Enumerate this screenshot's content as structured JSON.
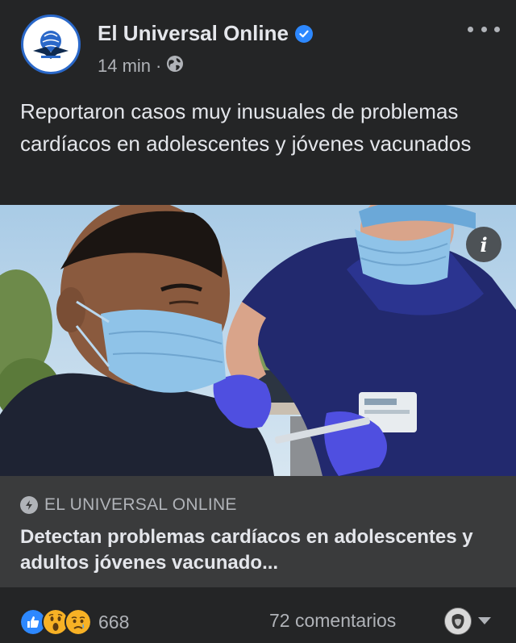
{
  "post": {
    "author": "El Universal Online",
    "time": "14 min",
    "separator": "·",
    "text": "Reportaron casos muy inusuales de problemas cardíacos en adolescentes y jóvenes vacunados"
  },
  "link_preview": {
    "source": "EL UNIVERSAL ONLINE",
    "headline": "Detectan problemas cardíacos en adolescentes y adultos jóvenes vacunado..."
  },
  "footer": {
    "reaction_count": "668",
    "comments": "72 comentarios"
  },
  "icons": {
    "verified": "verified-badge-icon",
    "audience": "globe-icon",
    "more": "more-options-icon",
    "info": "info-icon",
    "source": "lightning-icon",
    "reactions": [
      "like-icon",
      "wow-icon",
      "sad-icon"
    ]
  },
  "colors": {
    "background": "#242526",
    "link_box": "#3a3b3c",
    "accent_blue": "#2d88ff",
    "text_primary": "#e4e6eb",
    "text_secondary": "#b0b3b8"
  }
}
